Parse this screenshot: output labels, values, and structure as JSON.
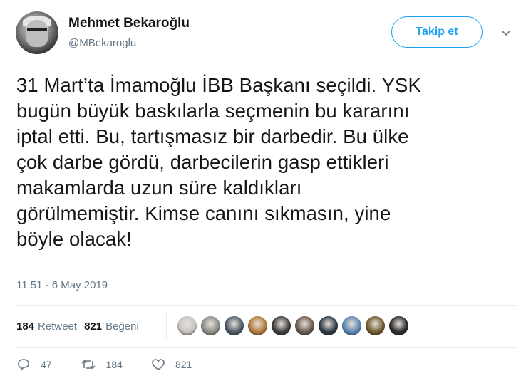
{
  "header": {
    "name": "Mehmet Bekaroğlu",
    "handle": "@MBekaroglu",
    "follow_label": "Takip et"
  },
  "tweet": {
    "text_lines": [
      "31 Mart’ta İmamoğlu İBB Başkanı seçildi. YSK",
      "bugün büyük baskılarla seçmenin bu kararını",
      "iptal etti. Bu, tartışmasız bir darbedir. Bu ülke",
      "çok darbe gördü, darbecilerin gasp ettikleri",
      "makamlarda uzun süre kaldıkları",
      "görülmemiştir. Kimse canını sıkmasın, yine",
      "böyle olacak!"
    ],
    "timestamp": "11:51 - 6 May 2019"
  },
  "stats": {
    "retweet_count": "184",
    "retweet_label": "Retweet",
    "like_count": "821",
    "like_label": "Beğeni"
  },
  "liker_avatars": [
    {
      "name": "liker-1",
      "color": "#c9c3c0"
    },
    {
      "name": "liker-2",
      "color": "#8a8f86"
    },
    {
      "name": "liker-3",
      "color": "#4e5a66"
    },
    {
      "name": "liker-4",
      "color": "#b07a3c"
    },
    {
      "name": "liker-5",
      "color": "#3d3d3d"
    },
    {
      "name": "liker-6",
      "color": "#6b5a4e"
    },
    {
      "name": "liker-7",
      "color": "#2e3a44"
    },
    {
      "name": "liker-8",
      "color": "#5b87b5"
    },
    {
      "name": "liker-9",
      "color": "#6e5a2e"
    },
    {
      "name": "liker-10",
      "color": "#2b2b2b"
    }
  ],
  "actions": {
    "reply_count": "47",
    "retweet_count": "184",
    "like_count": "821"
  },
  "colors": {
    "accent": "#1da1f2",
    "text": "#14171a",
    "muted": "#657786",
    "divider": "#e6ecf0"
  }
}
